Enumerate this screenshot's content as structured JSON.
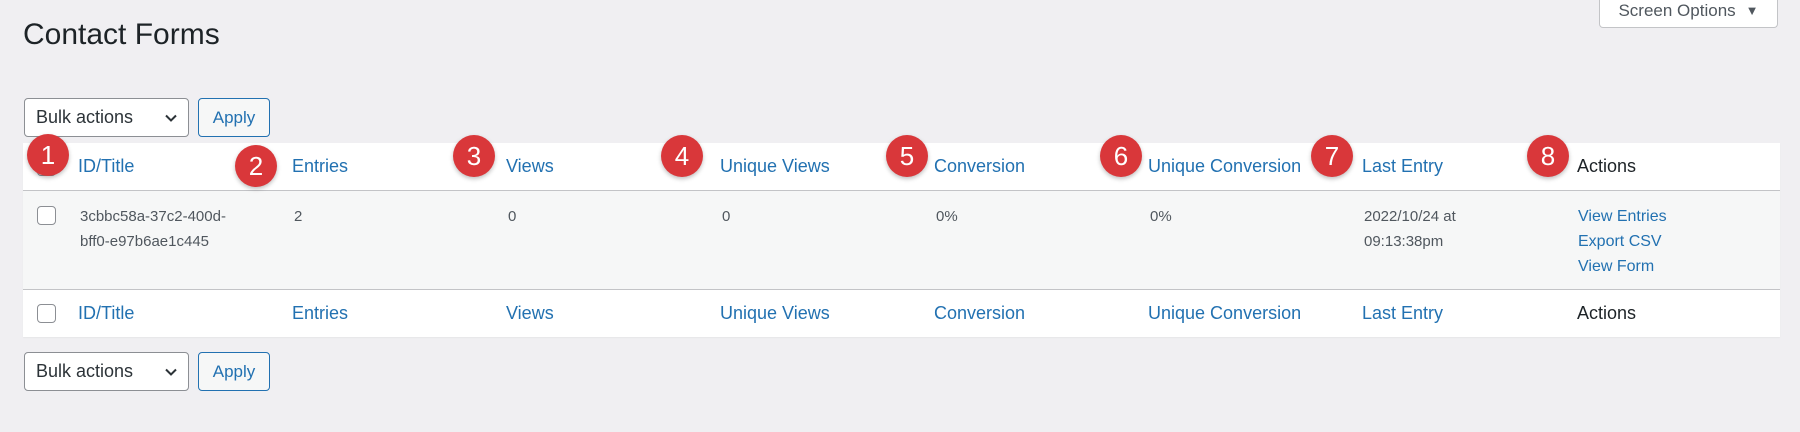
{
  "page": {
    "title": "Contact Forms"
  },
  "screen_options": {
    "label": "Screen Options",
    "caret_icon": "caret-down-icon"
  },
  "bulk": {
    "select_value": "Bulk actions",
    "apply_label": "Apply"
  },
  "columns": [
    "ID/Title",
    "Entries",
    "Views",
    "Unique Views",
    "Conversion",
    "Unique Conversion",
    "Last Entry",
    "Actions"
  ],
  "badges": [
    "1",
    "2",
    "3",
    "4",
    "5",
    "6",
    "7",
    "8"
  ],
  "rows": [
    {
      "id_title_line1": "3cbbc58a-37c2-400d-",
      "id_title_line2": "bff0-e97b6ae1c445",
      "entries": "2",
      "views": "0",
      "unique_views": "0",
      "conversion": "0%",
      "unique_conversion": "0%",
      "last_entry_line1": "2022/10/24 at",
      "last_entry_line2": "09:13:38pm",
      "actions": [
        "View Entries",
        "Export CSV",
        "View Form"
      ]
    }
  ],
  "colors": {
    "link": "#2271b1",
    "badge": "#d9373a",
    "background": "#f0eff2"
  }
}
